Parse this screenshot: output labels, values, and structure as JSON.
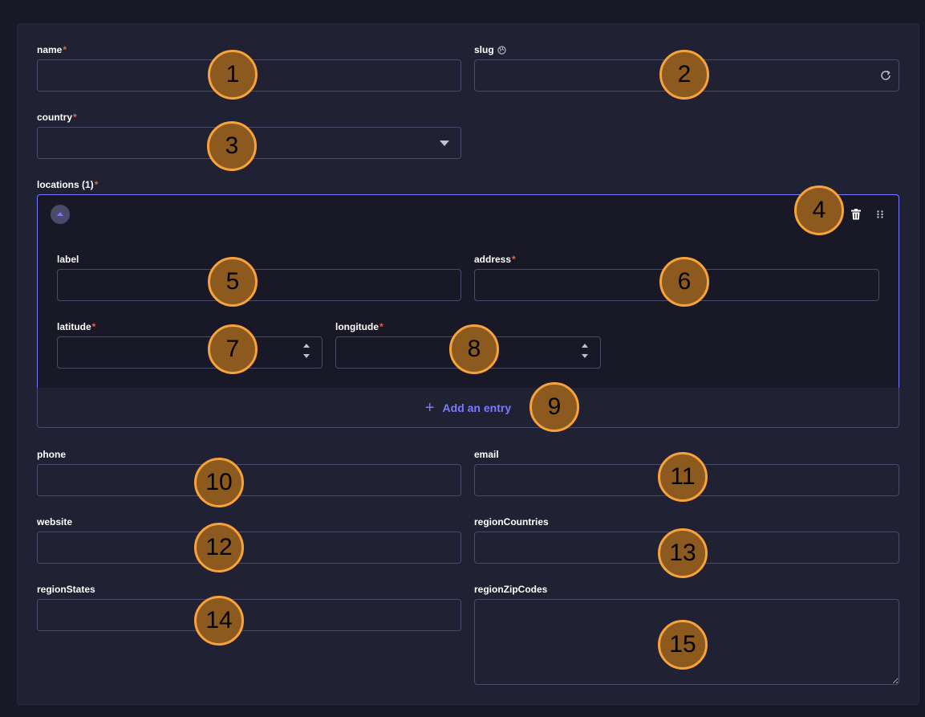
{
  "form": {
    "name": {
      "label": "name",
      "required": "*",
      "value": ""
    },
    "slug": {
      "label": "slug",
      "value": ""
    },
    "country": {
      "label": "country",
      "required": "*",
      "value": ""
    },
    "locations": {
      "label": "locations (1)",
      "required": "*",
      "entry": {
        "label": {
          "label": "label",
          "value": ""
        },
        "address": {
          "label": "address",
          "required": "*",
          "value": ""
        },
        "latitude": {
          "label": "latitude",
          "required": "*",
          "value": ""
        },
        "longitude": {
          "label": "longitude",
          "required": "*",
          "value": ""
        }
      },
      "add_entry_label": "Add an entry"
    },
    "phone": {
      "label": "phone",
      "value": ""
    },
    "email": {
      "label": "email",
      "value": ""
    },
    "website": {
      "label": "website",
      "value": ""
    },
    "regionCountries": {
      "label": "regionCountries",
      "value": ""
    },
    "regionStates": {
      "label": "regionStates",
      "value": ""
    },
    "regionZipCodes": {
      "label": "regionZipCodes",
      "value": ""
    }
  },
  "markers": [
    "1",
    "2",
    "3",
    "4",
    "5",
    "6",
    "7",
    "8",
    "9",
    "10",
    "11",
    "12",
    "13",
    "14",
    "15"
  ],
  "colors": {
    "background": "#181826",
    "panel": "#212134",
    "border": "#4a4a6a",
    "accent": "#7b79ff",
    "required": "#ee5e52",
    "marker_fill": "#8c5a1f",
    "marker_border": "#f7a23b"
  }
}
